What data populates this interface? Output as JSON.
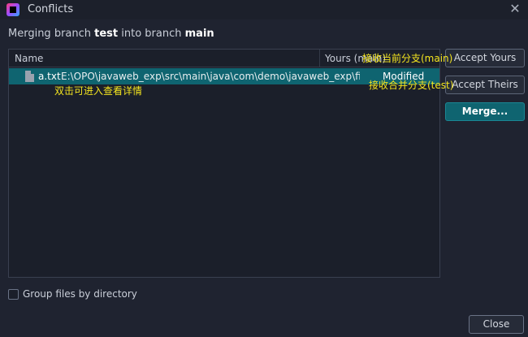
{
  "window": {
    "title": "Conflicts",
    "close_glyph": "✕",
    "icon": "intellij-app-icon"
  },
  "header": {
    "prefix": "Merging branch ",
    "source_branch": "test",
    "middle": " into branch ",
    "target_branch": "main"
  },
  "table": {
    "columns": {
      "name": "Name",
      "yours": "Yours (main)"
    },
    "rows": [
      {
        "file": "a.txt",
        "path": "E:\\OPO\\javaweb_exp\\src\\main\\java\\com\\demo\\javaweb_exp\\filters",
        "status_yours": "Modified"
      }
    ]
  },
  "annotations": {
    "double_click": "双击可进入查看详情",
    "accept_yours": "接收当前分支(main)",
    "accept_theirs": "接收合并分支(test)"
  },
  "buttons": {
    "accept_yours": "Accept Yours",
    "accept_theirs": "Accept Theirs",
    "merge": "Merge...",
    "close": "Close"
  },
  "options": {
    "group_by_directory": "Group files by directory",
    "group_by_directory_checked": false
  },
  "colors": {
    "background": "#1f2330",
    "selection": "#0f6470",
    "annotation": "#f4e51f"
  }
}
